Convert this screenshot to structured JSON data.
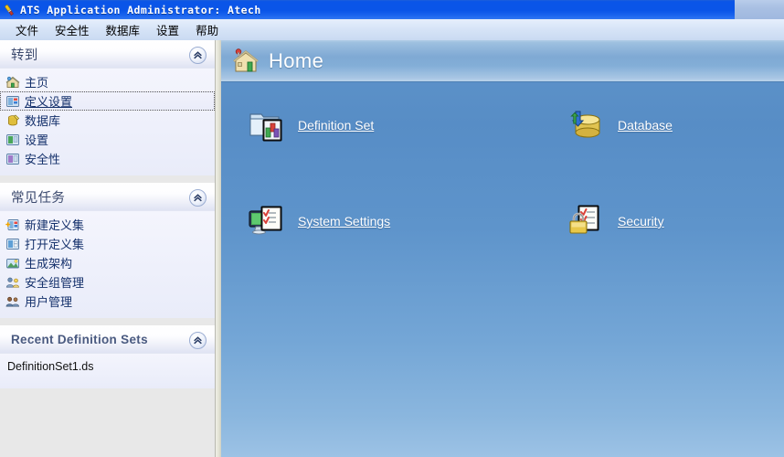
{
  "window": {
    "title": "ATS Application Administrator: Atech",
    "icon": "app-icon"
  },
  "menubar": {
    "items": [
      {
        "label": "文件",
        "name": "menu-file"
      },
      {
        "label": "安全性",
        "name": "menu-security"
      },
      {
        "label": "数据库",
        "name": "menu-database"
      },
      {
        "label": "设置",
        "name": "menu-settings"
      },
      {
        "label": "帮助",
        "name": "menu-help"
      }
    ]
  },
  "sidebar": {
    "panels": [
      {
        "title": "转到",
        "collapse_icon": "chevron-up-icon",
        "items": [
          {
            "label": "主页",
            "icon": "home-icon",
            "selected": false
          },
          {
            "label": "定义设置",
            "icon": "definition-set-icon",
            "selected": true
          },
          {
            "label": "数据库",
            "icon": "database-icon",
            "selected": false
          },
          {
            "label": "设置",
            "icon": "settings-icon",
            "selected": false
          },
          {
            "label": "安全性",
            "icon": "security-icon",
            "selected": false
          }
        ]
      },
      {
        "title": "常见任务",
        "collapse_icon": "chevron-up-icon",
        "items": [
          {
            "label": "新建定义集",
            "icon": "new-definition-set-icon",
            "selected": false
          },
          {
            "label": "打开定义集",
            "icon": "open-definition-set-icon",
            "selected": false
          },
          {
            "label": "生成架构",
            "icon": "generate-schema-icon",
            "selected": false
          },
          {
            "label": "安全组管理",
            "icon": "security-group-icon",
            "selected": false
          },
          {
            "label": "用户管理",
            "icon": "user-management-icon",
            "selected": false
          }
        ]
      },
      {
        "title": "Recent Definition Sets",
        "collapse_icon": "chevron-up-icon",
        "files": [
          {
            "label": "DefinitionSet1.ds"
          }
        ]
      }
    ]
  },
  "main": {
    "header": {
      "title": "Home",
      "icon": "home-house-icon"
    },
    "tiles": [
      {
        "label": "Definition Set",
        "icon": "definition-set-folder-icon"
      },
      {
        "label": "Database",
        "icon": "database-cylinder-icon"
      },
      {
        "label": "System Settings",
        "icon": "system-settings-icon"
      },
      {
        "label": "Security",
        "icon": "security-lock-icon"
      }
    ]
  },
  "colors": {
    "titlebar_blue": "#0a55e8",
    "main_blue": "#5e93c9",
    "link_white": "#ffffff",
    "sidebar_panel": "#eef0fb",
    "sidebar_link": "#14306b"
  }
}
